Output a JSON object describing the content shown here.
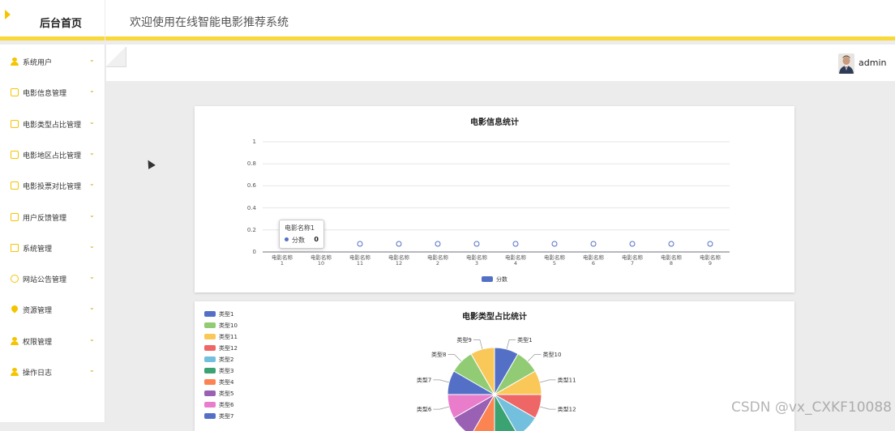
{
  "header": {
    "home_title": "后台首页",
    "system_title": "欢迎使用在线智能电影推荐系统"
  },
  "sidebar": {
    "items": [
      {
        "label": "系统用户",
        "icon": "user-icon"
      },
      {
        "label": "电影信息管理",
        "icon": "edit-icon"
      },
      {
        "label": "电影类型占比管理",
        "icon": "edit-icon"
      },
      {
        "label": "电影地区占比管理",
        "icon": "edit-icon"
      },
      {
        "label": "电影投票对比管理",
        "icon": "edit-icon"
      },
      {
        "label": "用户反馈管理",
        "icon": "edit-icon"
      },
      {
        "label": "系统管理",
        "icon": "image-icon"
      },
      {
        "label": "网站公告管理",
        "icon": "info-icon"
      },
      {
        "label": "资源管理",
        "icon": "pin-icon"
      },
      {
        "label": "权限管理",
        "icon": "user-icon"
      },
      {
        "label": "操作日志",
        "icon": "user-icon"
      }
    ]
  },
  "user": {
    "name": "admin"
  },
  "bar_chart": {
    "title": "电影信息统计",
    "legend": "分数",
    "tooltip": {
      "title": "电影名称1",
      "series": "分数",
      "value": "0"
    }
  },
  "pie_chart": {
    "title": "电影类型占比统计"
  },
  "watermark": "CSDN @vx_CXKF10088",
  "colors": {
    "accent": "#f9d93a",
    "series_blue": "#5470c6"
  },
  "chart_data": [
    {
      "type": "line",
      "title": "电影信息统计",
      "categories": [
        "电影名称\n1",
        "电影名称\n10",
        "电影名称\n11",
        "电影名称\n12",
        "电影名称\n2",
        "电影名称\n3",
        "电影名称\n4",
        "电影名称\n5",
        "电影名称\n6",
        "电影名称\n7",
        "电影名称\n8",
        "电影名称\n9"
      ],
      "series": [
        {
          "name": "分数",
          "values": [
            0,
            0,
            0,
            0,
            0,
            0,
            0,
            0,
            0,
            0,
            0,
            0
          ]
        }
      ],
      "yticks": [
        "0",
        "0.2",
        "0.4",
        "0.6",
        "0.8",
        "1"
      ],
      "ylim": [
        0,
        1
      ],
      "grid": true,
      "legend": "bottom"
    },
    {
      "type": "pie",
      "title": "电影类型占比统计",
      "legend": [
        "类型1",
        "类型10",
        "类型11",
        "类型12",
        "类型2",
        "类型3",
        "类型4",
        "类型5",
        "类型6",
        "类型7"
      ],
      "labels": [
        "类型1",
        "类型10",
        "类型11",
        "类型12",
        "类型9",
        "类型8",
        "类型7",
        "类型6"
      ],
      "colors": [
        "#5470c6",
        "#91cc75",
        "#fac858",
        "#ee6666",
        "#73c0de",
        "#3ba272",
        "#fc8452",
        "#9a60b4",
        "#ea7ccc",
        "#5470c6",
        "#91cc75",
        "#fac858"
      ],
      "values": [
        1,
        1,
        1,
        1,
        1,
        1,
        1,
        1,
        1,
        1,
        1,
        1
      ],
      "legend_position": "left"
    }
  ]
}
